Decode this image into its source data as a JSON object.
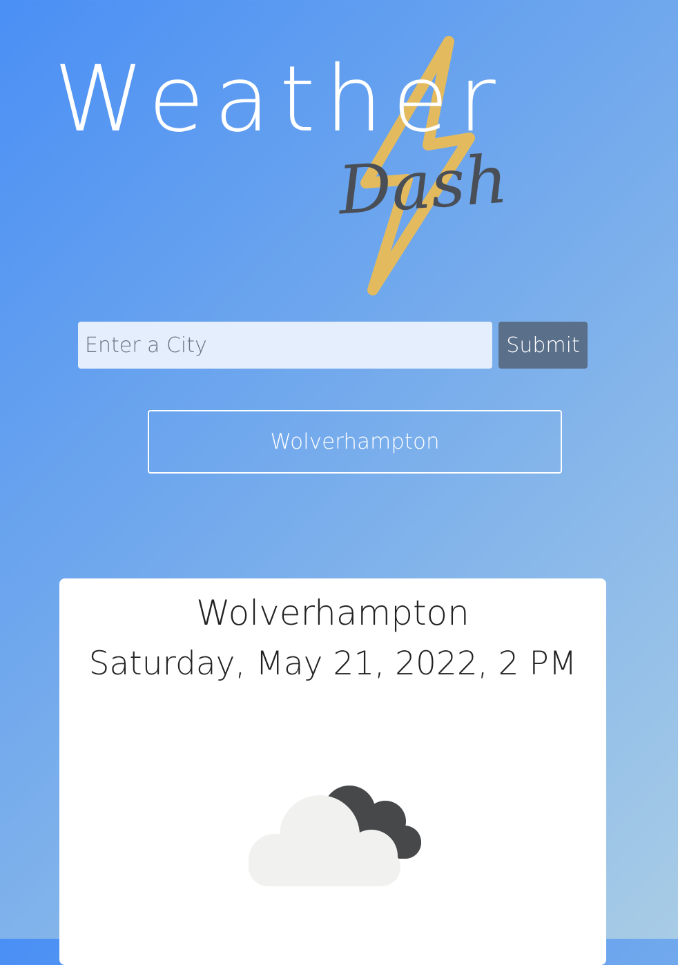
{
  "logo": {
    "word": "Weather",
    "script": "Dash",
    "bolt_color": "#e3bb5e",
    "script_color": "#4a4f57"
  },
  "search": {
    "placeholder": "Enter a City",
    "value": "",
    "submit_label": "Submit"
  },
  "history": {
    "cities": [
      "Wolverhampton"
    ]
  },
  "current_weather": {
    "city": "Wolverhampton",
    "datetime": "Saturday, May 21, 2022, 2 PM",
    "icon": "broken-clouds-icon"
  },
  "colors": {
    "background_start": "#4a8ff5",
    "background_end": "#a8cce6",
    "submit_button": "#5a6f8a",
    "card": "#ffffff",
    "cloud_light": "#f1f1f0",
    "cloud_dark": "#47484a"
  }
}
